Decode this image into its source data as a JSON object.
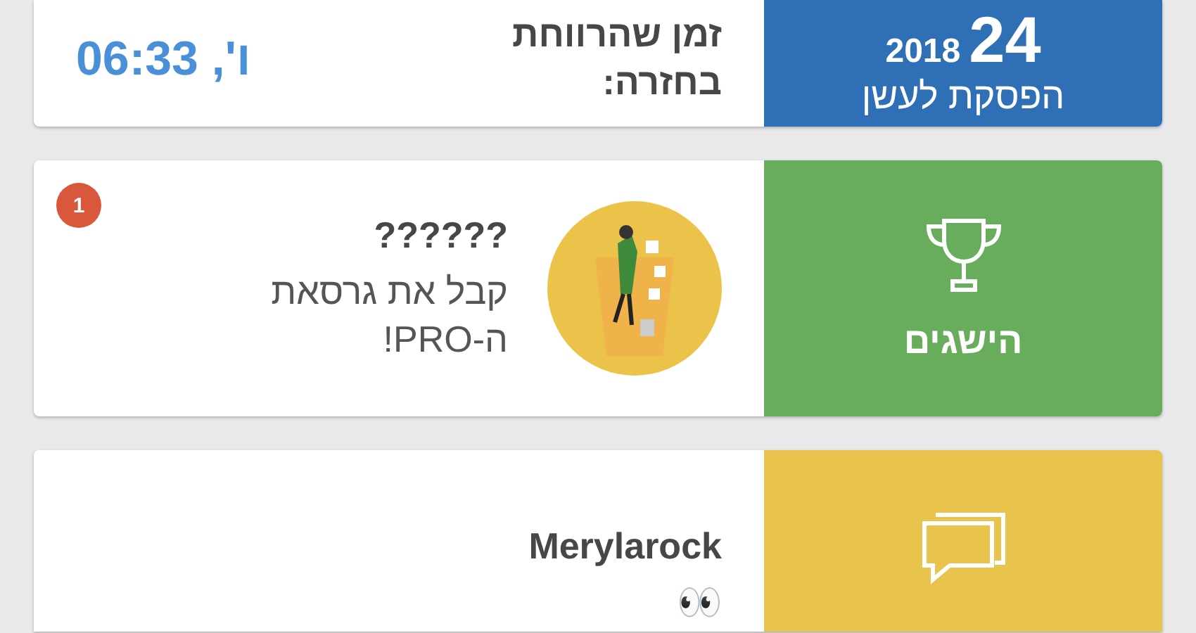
{
  "cards": [
    {
      "kind": "quit-date",
      "panel": {
        "day": "24",
        "year": "2018",
        "label": "הפסקת לעשן",
        "color": "#2f6fb6"
      },
      "title": "זמן שהרווחת בחזרה:",
      "value": "ו', 06:33"
    },
    {
      "kind": "achievement",
      "panel": {
        "label": "הישגים",
        "color": "#67ad5b"
      },
      "badge": "1",
      "title": "??????",
      "text": "קבל את גרסאת ה-PRO!"
    },
    {
      "kind": "forum",
      "panel": {
        "color": "#e8c44c"
      },
      "title": "Merylarock",
      "text": "👀"
    }
  ]
}
